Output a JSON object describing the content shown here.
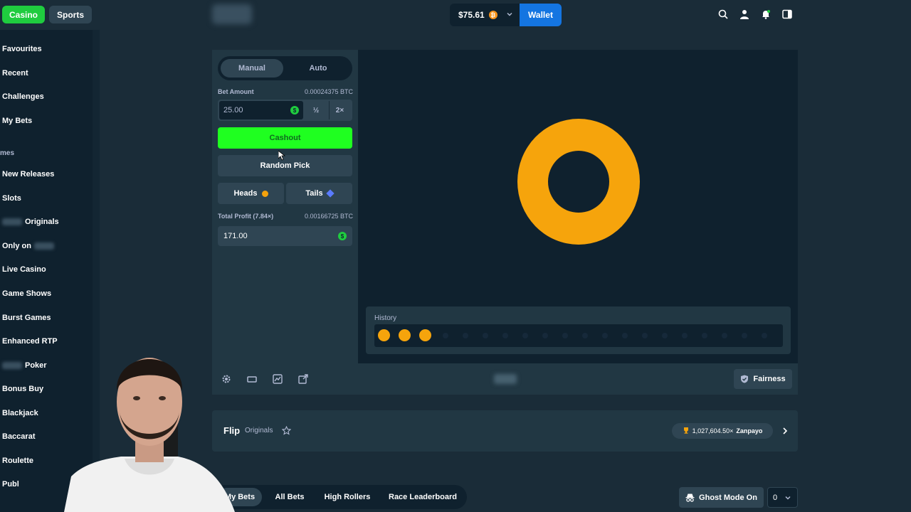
{
  "topbar": {
    "casino_label": "Casino",
    "sports_label": "Sports",
    "balance": "$75.61",
    "wallet_label": "Wallet"
  },
  "sidebar": {
    "items": [
      {
        "label": "Favourites"
      },
      {
        "label": "Recent"
      },
      {
        "label": "Challenges"
      },
      {
        "label": "My Bets"
      }
    ],
    "section_label": "mes",
    "games": [
      {
        "label": "New Releases"
      },
      {
        "label": "Slots"
      },
      {
        "label": "Originals"
      },
      {
        "label": "Only on"
      },
      {
        "label": "Live Casino"
      },
      {
        "label": "Game Shows"
      },
      {
        "label": "Burst Games"
      },
      {
        "label": "Enhanced RTP"
      },
      {
        "label": "Poker"
      },
      {
        "label": "Bonus Buy"
      },
      {
        "label": "Blackjack"
      },
      {
        "label": "Baccarat"
      },
      {
        "label": "Roulette"
      },
      {
        "label": "Publ"
      }
    ]
  },
  "bet_panel": {
    "tab_manual": "Manual",
    "tab_auto": "Auto",
    "bet_amount_label": "Bet Amount",
    "bet_amount_btc": "0.00024375 BTC",
    "bet_amount_value": "25.00",
    "half_label": "½",
    "double_label": "2×",
    "cashout_label": "Cashout",
    "random_pick_label": "Random Pick",
    "heads_label": "Heads",
    "tails_label": "Tails",
    "total_profit_label": "Total Profit (7.84×)",
    "total_profit_btc": "0.00166725 BTC",
    "total_profit_value": "171.00"
  },
  "history": {
    "title": "History",
    "results": [
      "heads",
      "heads",
      "heads"
    ]
  },
  "footer": {
    "fairness_label": "Fairness"
  },
  "info": {
    "game_title": "Flip",
    "game_tag": "Originals",
    "record": "1,027,604.50×",
    "record_user": "Zanpayo"
  },
  "bets": {
    "tabs": [
      "My Bets",
      "All Bets",
      "High Rollers",
      "Race Leaderboard"
    ],
    "ghost_label": "Ghost Mode On",
    "count": "0"
  },
  "colors": {
    "accent_green": "#1fff20",
    "coin_gold": "#f6a40c",
    "wallet_blue": "#1475e1"
  }
}
